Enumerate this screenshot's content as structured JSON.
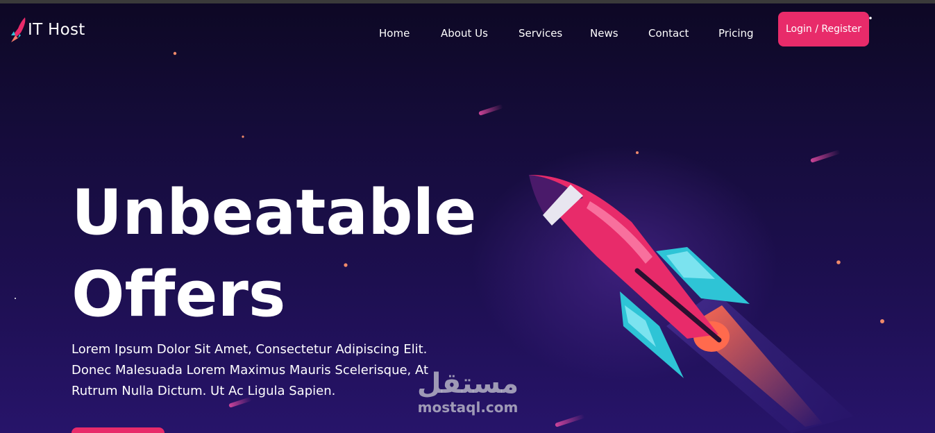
{
  "brand": {
    "name": "IT Host",
    "icon": "rocket-icon"
  },
  "nav": {
    "items": [
      {
        "label": "Home"
      },
      {
        "label": "About Us"
      },
      {
        "label": "Services"
      },
      {
        "label": "News"
      },
      {
        "label": "Contact"
      },
      {
        "label": "Pricing"
      }
    ],
    "login_label": "Login / Register"
  },
  "hero": {
    "title_line1": "Unbeatable",
    "title_line2": "Offers",
    "text": "Lorem Ipsum Dolor Sit Amet, Consectetur Adipiscing Elit. Donec Malesuada Lorem Maximus Mauris Scelerisque, At Rutrum Nulla Dictum. Ut Ac Ligula Sapien.",
    "illustration": "rocket-illustration"
  },
  "watermark": {
    "arabic": "مستقل",
    "latin": "mostaql.com"
  },
  "colors": {
    "accent": "#e82b6a",
    "background_top": "#0d0824",
    "background_bottom": "#27146a",
    "rocket_fin": "#2ec4d6"
  }
}
